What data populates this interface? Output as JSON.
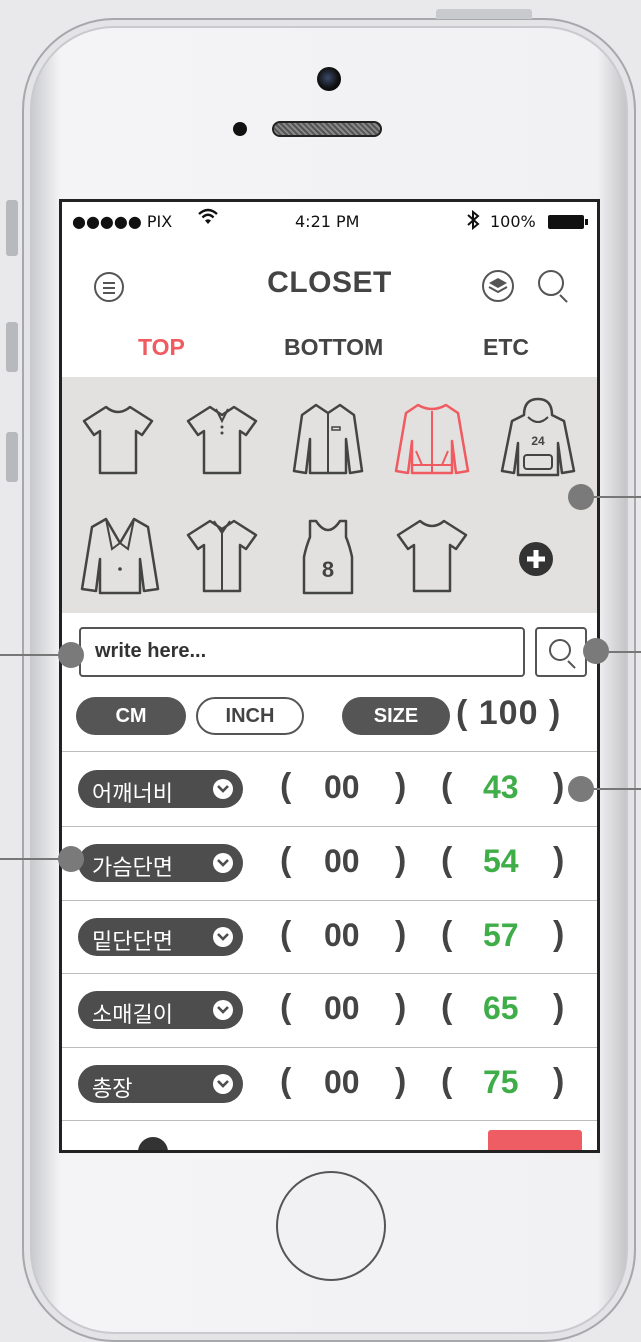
{
  "status_bar": {
    "carrier": "●●●●● PIX",
    "time": "4:21 PM",
    "battery": "100%"
  },
  "header": {
    "title": "CLOSET"
  },
  "tabs": [
    {
      "label": "TOP",
      "active": true
    },
    {
      "label": "BOTTOM",
      "active": false
    },
    {
      "label": "ETC",
      "active": false
    }
  ],
  "clothes": [
    {
      "name": "tshirt-icon",
      "selected": false
    },
    {
      "name": "polo-shirt-icon",
      "selected": false
    },
    {
      "name": "dress-shirt-icon",
      "selected": false
    },
    {
      "name": "jacket-icon",
      "selected": true
    },
    {
      "name": "hoodie-icon",
      "selected": false,
      "number": "24"
    },
    {
      "name": "blazer-icon",
      "selected": false
    },
    {
      "name": "short-sleeve-shirt-icon",
      "selected": false
    },
    {
      "name": "tank-top-icon",
      "selected": false,
      "number": "8"
    },
    {
      "name": "basic-tshirt-icon",
      "selected": false
    },
    {
      "name": "add-icon",
      "selected": false
    }
  ],
  "search": {
    "placeholder": "write here..."
  },
  "units": {
    "cm": "CM",
    "inch": "INCH",
    "size_label": "SIZE",
    "size_value": "( 100 )",
    "selected": "CM"
  },
  "measurements": [
    {
      "label": "어깨너비",
      "input": "00",
      "value": "43"
    },
    {
      "label": "가슴단면",
      "input": "00",
      "value": "54"
    },
    {
      "label": "밑단단면",
      "input": "00",
      "value": "57"
    },
    {
      "label": "소매길이",
      "input": "00",
      "value": "65"
    },
    {
      "label": "총장",
      "input": "00",
      "value": "75"
    }
  ],
  "colors": {
    "accent_red": "#ef5b61",
    "value_green": "#3fae49",
    "panel_bg": "#e2e1df",
    "dark_pill": "#4d4d4d"
  }
}
